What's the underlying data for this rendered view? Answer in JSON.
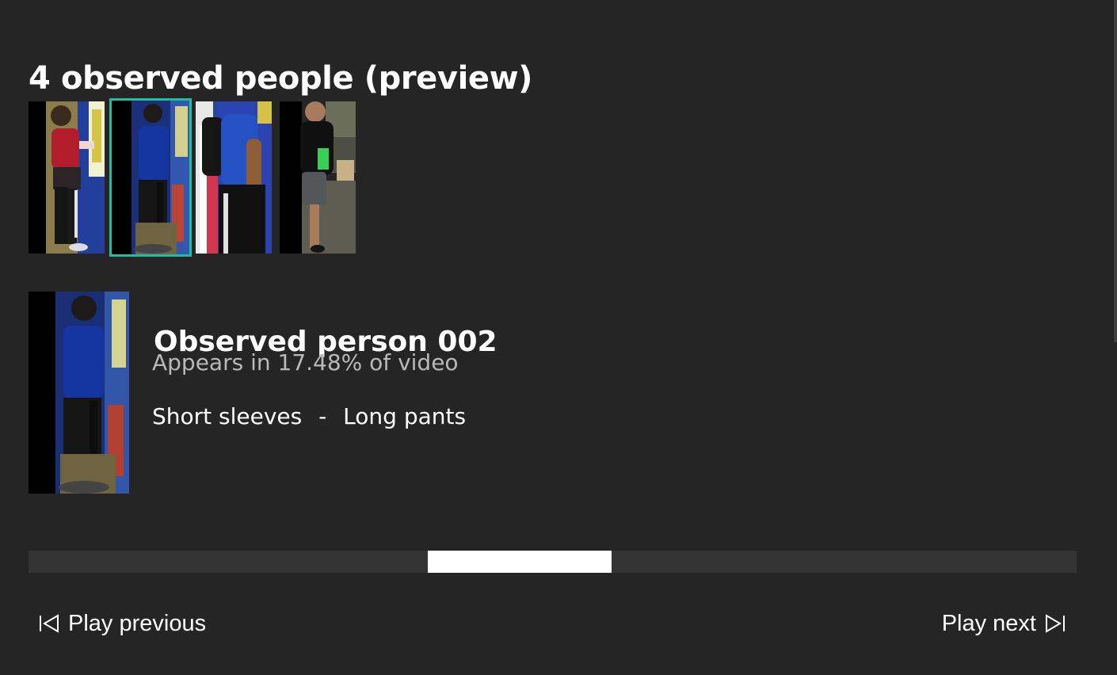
{
  "header": {
    "title": "4 observed people (preview)"
  },
  "people": [
    {
      "id": "person-001",
      "thumbnail_icon": "person-thumbnail-red-shirt",
      "selected": false
    },
    {
      "id": "person-002",
      "thumbnail_icon": "person-thumbnail-blue-shirt",
      "selected": true
    },
    {
      "id": "person-003",
      "thumbnail_icon": "person-thumbnail-backpack",
      "selected": false
    },
    {
      "id": "person-004",
      "thumbnail_icon": "person-thumbnail-black-shirt",
      "selected": false
    }
  ],
  "selected_person": {
    "name": "Observed person 002",
    "appearance_text": "Appears in 17.48% of video",
    "appearance_percent": 17.48,
    "attributes": {
      "sleeves": "Short sleeves",
      "separator": "-",
      "pants": "Long pants"
    }
  },
  "timeline": {
    "segment_start_fraction": 0.381,
    "segment_end_fraction": 0.556
  },
  "controls": {
    "previous_label": "Play previous",
    "previous_icon": "skip-previous-icon",
    "next_label": "Play next",
    "next_icon": "skip-next-icon"
  },
  "colors": {
    "background": "#252525",
    "selected_border": "#1fbf9e",
    "timeline_track": "#343434",
    "timeline_segment": "#ffffff",
    "secondary_text": "#b9b9b9"
  }
}
